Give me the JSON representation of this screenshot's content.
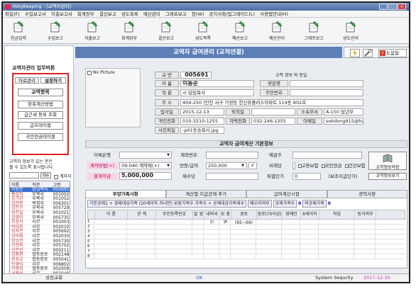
{
  "window": {
    "title": "HolyKeeping - [교역자관리]",
    "min": "_",
    "max": "□",
    "close": "×"
  },
  "menu": [
    "파일(F)",
    "수입보고서",
    "지출보고서",
    "회계장부",
    "결산보고",
    "성도목록",
    "예산관리",
    "그래프보고",
    "창(W)",
    "공지사항/업그레이드(L)",
    "사용법안내(H)"
  ],
  "toolbar": [
    {
      "label": "헌금입력",
      "icon": "pen-ledger-icon"
    },
    {
      "label": "수입보고",
      "icon": "pen-ledger-icon"
    },
    {
      "label": "지출보고",
      "icon": "pen-ledger-icon"
    },
    {
      "label": "회계장부",
      "icon": "pen-ledger-icon"
    },
    {
      "label": "결산보고",
      "icon": "pen-ledger-icon"
    },
    {
      "label": "성도목록",
      "icon": "pen-ledger-icon"
    },
    {
      "label": "예산보고",
      "icon": "pen-ledger-icon"
    },
    {
      "label": "예산관리",
      "icon": "pen-ledger-icon"
    },
    {
      "label": "그래프보고",
      "icon": "chart-icon"
    },
    {
      "label": "성도관리",
      "icon": "pen-ledger-icon"
    }
  ],
  "left": {
    "title": "교역자관리 업무버튼",
    "tab1": "자료관리",
    "tab2": "설정하기",
    "buttons": [
      "교역항목",
      "항목계산방법",
      "급근세 등록 조회",
      "급호테이블",
      "국민연금테이블"
    ],
    "info_line1": "교역자 정보가 있는 분은",
    "info_line2": "볼 수 있도록 표시됩니다.",
    "go": "Go",
    "check": "계자자",
    "grid_headers": [
      "이름",
      "직분",
      "고번"
    ],
    "rows": [
      [
        "이동순",
        "담임목사",
        "005691"
      ],
      [
        "홍갑하",
        "부목사",
        "001002"
      ],
      [
        "김기한",
        "부목사",
        "001052"
      ],
      [
        "김한준",
        "목회자",
        "006301"
      ],
      [
        "김인구",
        "부목사",
        "005729"
      ],
      [
        "정진일",
        "부목사",
        "001021"
      ],
      [
        "김영이",
        "부목사",
        "005735"
      ],
      [
        "조상자",
        "사무",
        "001003"
      ],
      [
        "박대희",
        "사모",
        "002010"
      ],
      [
        "김하은",
        "사무",
        "005692"
      ],
      [
        "강미화",
        "사무",
        "002030"
      ],
      [
        "양수연",
        "사무",
        "005730"
      ],
      [
        "신현숙",
        "사무",
        "005702"
      ],
      [
        "신은진",
        "사무",
        "000211"
      ],
      [
        "김충현",
        "협동장로",
        "002148"
      ],
      [
        "윤성교",
        "협동장로",
        "005041"
      ],
      [
        "만경이",
        "사무",
        "006802"
      ],
      [
        "이영희",
        "협동장로",
        "002009"
      ],
      [
        "서종순",
        "사무",
        "002040"
      ],
      [
        "김방가",
        "협동권사",
        "003510"
      ]
    ]
  },
  "banner": "교역자 급여관리 (교적연결)",
  "help": "도움말",
  "profile": {
    "no_picture": "No Picture",
    "qual_info": "교적 정보 와 동일",
    "labels": {
      "code": "교 번",
      "name": "이 름",
      "position": "직 분",
      "address": "주 소",
      "hire": "입사일",
      "retire": "퇴직일",
      "church_tel": "개인전화",
      "mobile": "자택전화",
      "photo": "사진파일",
      "eng_name": "영문명",
      "resident": "주민번호",
      "dept": "소속부서",
      "email": "이메일"
    },
    "values": {
      "code": "005691",
      "name": "이동순",
      "position": "시 담임목사",
      "address": "404-250 |인천 서구 가정동 한신휴플러스아파트 114동 802호",
      "hire": "2015-12-13",
      "retire": "",
      "church_tel": "010-3210-1255",
      "mobile": "032-246-1255",
      "photo": "-p01동숭목사.jpg",
      "eng_name": "",
      "resident": "",
      "dept": "A-150 담년부",
      "email": "sokdong915@hanmail.net"
    }
  },
  "salary": {
    "title": "교역자 급여계산 기본정보",
    "labels": {
      "bank": "이체은행",
      "account": "계좌번호",
      "depositor": "예금주",
      "method": "계약방법(+)",
      "annual": "연봉/급여",
      "ratio": "비례당",
      "pay": "월계약금",
      "deduct": "제수당",
      "special": "특별단가",
      "insure1": "고용보험",
      "insure2": "국민연금",
      "insure3": "건강보험"
    },
    "values": {
      "bank": "",
      "account": "",
      "depositor": "",
      "method": "09-040 계약제(+)",
      "annual": "250,000",
      "f": "F",
      "ratio": "",
      "pay": "5,000,000",
      "deduct": "",
      "special": "0",
      "note": "(보조지급단가)"
    },
    "btn1": "교역정보저장",
    "btn2": "교역정보보기"
  },
  "tabs": [
    "부양가족사항",
    "계산별 지급공제 추가",
    "급여계산시점",
    "경력사항"
  ],
  "dependents": {
    "bar": "기본공제1 + 경제대상가족 (20세이하 자녀만) 보장가족수 가족수 + 공제대상가족세수",
    "total_label": "배우자여부",
    "count_label": "공제가족수",
    "count": "0",
    "nonpay_label": "비공제가족",
    "nonpay": "0",
    "headers": [
      "",
      "이 름",
      "관 계",
      "주민등록번호",
      "말 영",
      "내외국인",
      "보 충 편",
      "경로(65~69)",
      "경로(70이상)",
      "장애인",
      "6세이하",
      "직업",
      "동거여부"
    ],
    "rows": [
      "1",
      "2",
      "3",
      "4",
      "5",
      "6",
      "7",
      "8"
    ]
  },
  "status": {
    "left": "성전교회",
    "mid": "OK",
    "right": "System Sequrity",
    "date": "2017-12-30"
  }
}
